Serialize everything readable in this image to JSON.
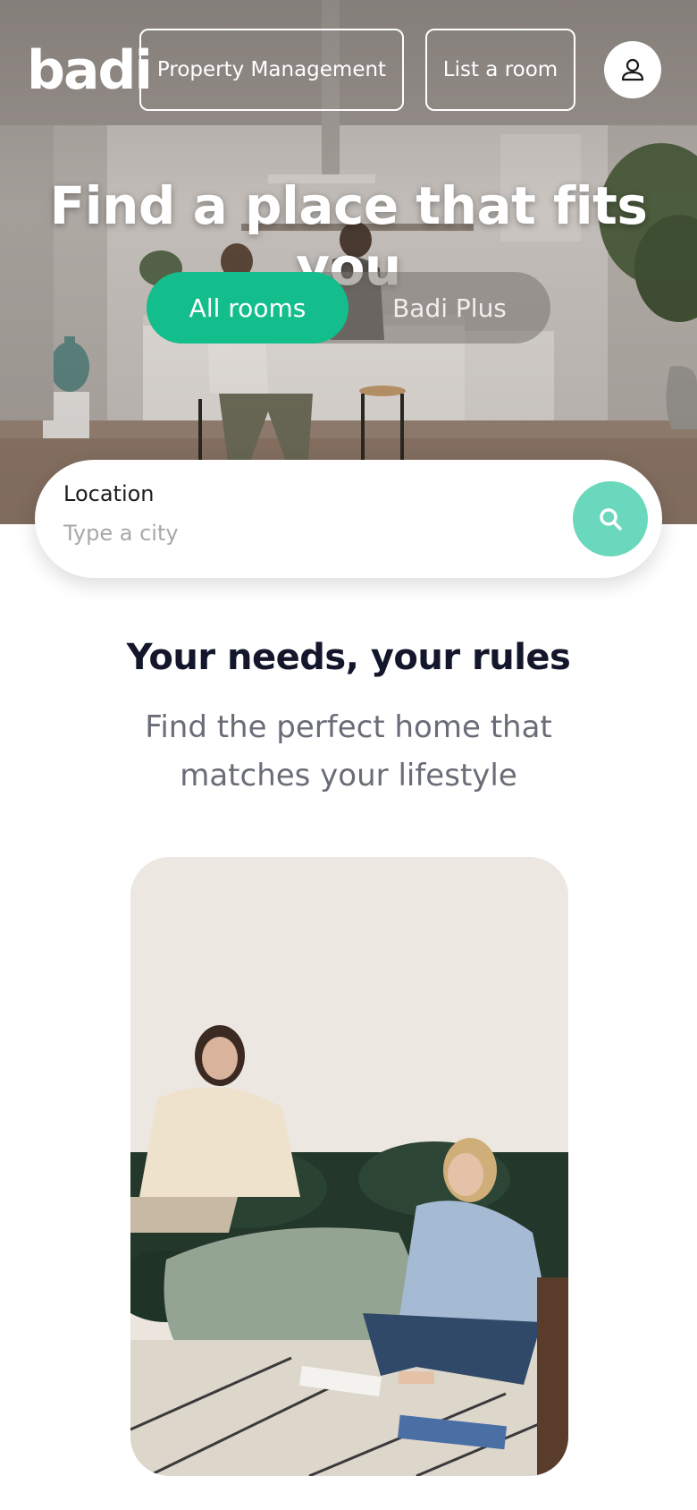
{
  "header": {
    "logo_text": "badi",
    "property_management_label": "Property Management",
    "list_room_label": "List a room",
    "profile_icon": "user-icon"
  },
  "hero": {
    "title": "Find a place that fits you",
    "tabs": [
      {
        "label": "All rooms",
        "active": true
      },
      {
        "label": "Badi Plus",
        "active": false
      }
    ]
  },
  "search": {
    "label": "Location",
    "placeholder": "Type a city",
    "value": "",
    "button_icon": "search-icon"
  },
  "section": {
    "heading": "Your needs, your rules",
    "subtitle": "Find the perfect home that matches your lifestyle"
  },
  "colors": {
    "accent": "#14be8c",
    "search_button": "#6ad8bc",
    "heading": "#14172b",
    "subtitle": "#6a6d78"
  }
}
